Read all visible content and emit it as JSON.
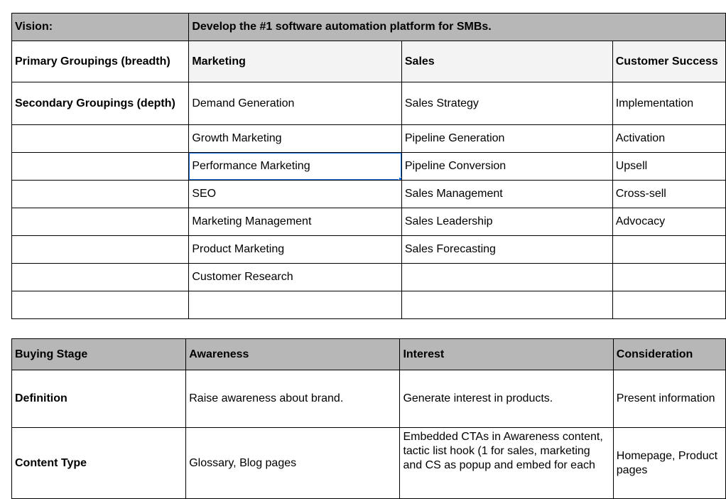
{
  "table1": {
    "vision_label": "Vision:",
    "vision_text": "Develop the #1 software automation platform for SMBs.",
    "primary_label": "Primary Groupings (breadth)",
    "columns": [
      "Marketing",
      "Sales",
      "Customer Success"
    ],
    "secondary_label": "Secondary Groupings (depth)",
    "rows": [
      [
        "Demand Generation",
        "Sales Strategy",
        "Implementation"
      ],
      [
        "Growth Marketing",
        "Pipeline Generation",
        "Activation"
      ],
      [
        "Performance Marketing",
        "Pipeline Conversion",
        "Upsell"
      ],
      [
        "SEO",
        "Sales Management",
        "Cross-sell"
      ],
      [
        "Marketing Management",
        "Sales Leadership",
        "Advocacy"
      ],
      [
        "Product Marketing",
        "Sales Forecasting",
        ""
      ],
      [
        "Customer Research",
        "",
        ""
      ],
      [
        "",
        "",
        ""
      ]
    ],
    "selected_cell": "Performance Marketing"
  },
  "table2": {
    "header_label": "Buying Stage",
    "stages": [
      "Awareness",
      "Interest",
      "Consideration"
    ],
    "definition_label": "Definition",
    "definitions": [
      "Raise awareness about brand.",
      "Generate interest in products.",
      "Present information"
    ],
    "content_type_label": "Content Type",
    "content_types": [
      "Glossary, Blog pages",
      "Embedded CTAs in Awareness content, tactic list hook (1 for sales, marketing and CS as popup and embed for each",
      "Homepage, Product pages"
    ]
  }
}
